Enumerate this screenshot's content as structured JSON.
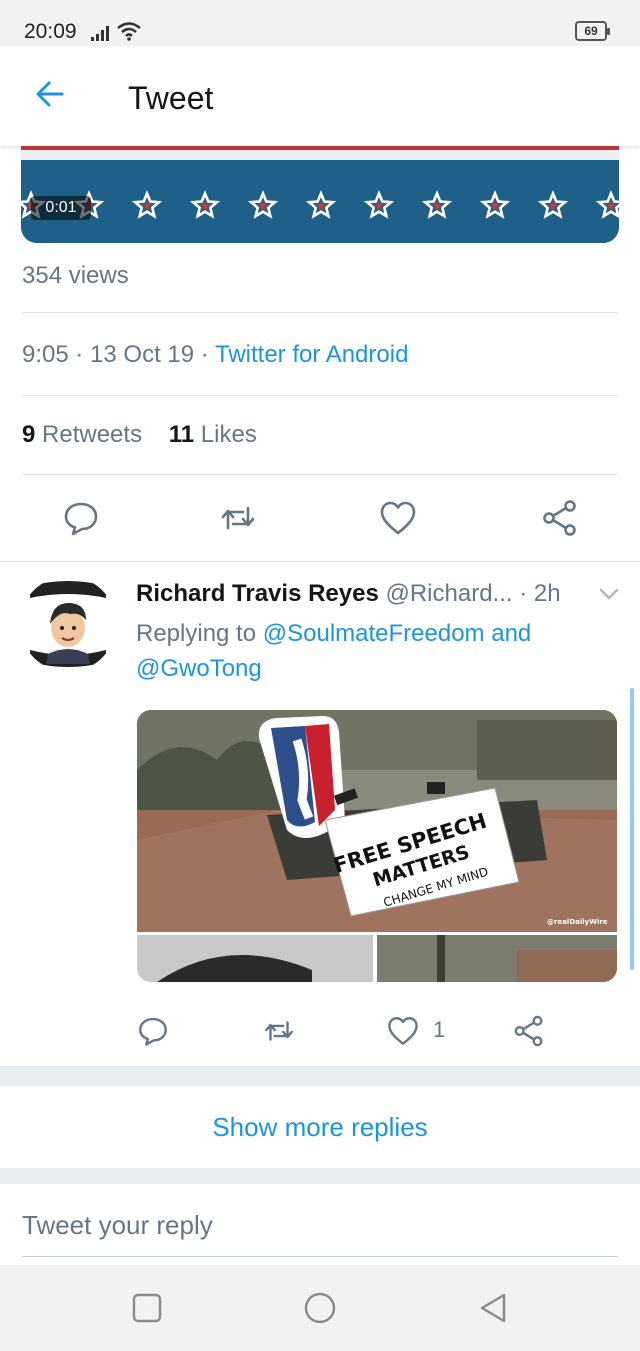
{
  "status_bar": {
    "time": "20:09",
    "battery": "69"
  },
  "header": {
    "title": "Tweet",
    "back_icon": "arrow-left-icon"
  },
  "video": {
    "duration": "0:01"
  },
  "tweet": {
    "views": "354 views",
    "time": "9:05 · 13 Oct 19 · ",
    "source": "Twitter for Android",
    "retweets_count": "9",
    "retweets_label": " Retweets",
    "likes_count": "11",
    "likes_label": " Likes",
    "actions": [
      "reply-icon",
      "retweet-icon",
      "like-icon",
      "share-icon"
    ]
  },
  "reply": {
    "name": "Richard Travis Reyes",
    "handle": " @Richard...",
    "time": " · 2h",
    "replying_prefix": "Replying to ",
    "mention_1": "@SoulmateFreedom",
    "and": " and",
    "mention_2": "@GwoTong",
    "like_count": "1",
    "media": {
      "sign_line1": "FREE SPEECH",
      "sign_line2": "MATTERS",
      "sign_line3": "CHANGE MY MIND",
      "watermark": "@realDailyWire"
    }
  },
  "show_more_replies": "Show more replies",
  "reply_input": {
    "placeholder": "Tweet your reply"
  },
  "colors": {
    "accent": "#1b95e0",
    "secondary_text": "#657786",
    "divider": "#dfe3e6"
  }
}
